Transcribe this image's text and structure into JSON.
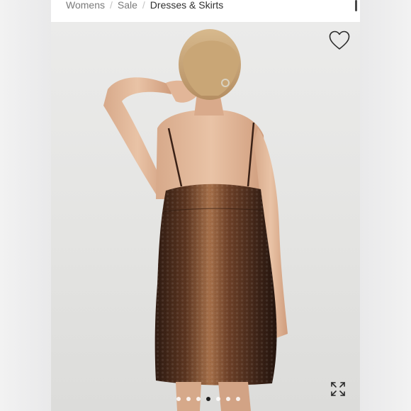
{
  "breadcrumb": {
    "items": [
      {
        "label": "Womens"
      },
      {
        "label": "Sale"
      },
      {
        "label": "Dresses & Skirts"
      }
    ],
    "separator": "/"
  },
  "product_gallery": {
    "image_alt": "Model wearing a brown sequin slip mini dress, shown from the back",
    "wishlist_icon": "heart-outline-icon",
    "expand_icon": "expand-arrows-icon",
    "slide_count": 7,
    "active_slide": 4
  },
  "colors": {
    "background": "#ffffff",
    "photo_background": "#e6e6e4",
    "dress": "#4a2a1a",
    "dress_highlight": "#a7714c",
    "active_dot": "#1e1e1e"
  }
}
